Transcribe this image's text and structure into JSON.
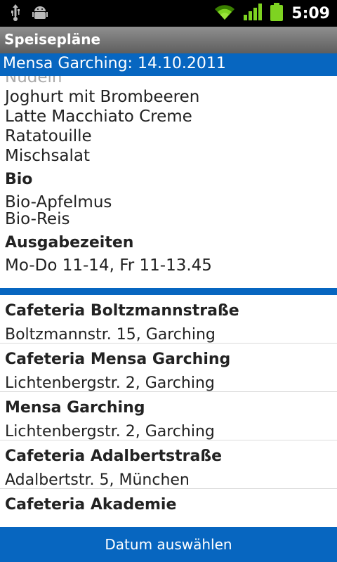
{
  "status_bar": {
    "time": "5:09",
    "icons": [
      "usb-icon",
      "android-debug-icon",
      "wifi-icon",
      "signal-icon",
      "battery-icon"
    ]
  },
  "app": {
    "title": "Speisepläne"
  },
  "header": {
    "title": "Mensa Garching: 14.10.2011"
  },
  "menu": {
    "items_top": [
      "Nudeln",
      "Joghurt mit Brombeeren",
      "Latte Macchiato Creme",
      "Ratatouille",
      "Mischsalat"
    ],
    "bio_heading": "Bio",
    "bio_items": [
      "Bio-Apfelmus",
      "Bio-Reis"
    ],
    "hours_heading": "Ausgabezeiten",
    "hours": "Mo-Do 11-14, Fr 11-13.45"
  },
  "locations": [
    {
      "name": "Cafeteria Boltzmannstraße",
      "address": "Boltzmannstr. 15, Garching"
    },
    {
      "name": "Cafeteria Mensa Garching",
      "address": "Lichtenbergstr. 2, Garching"
    },
    {
      "name": "Mensa Garching",
      "address": "Lichtenbergstr. 2, Garching"
    },
    {
      "name": "Cafeteria Adalbertstraße",
      "address": "Adalbertstr. 5, München"
    },
    {
      "name": "Cafeteria Akademie",
      "address": ""
    }
  ],
  "colors": {
    "accent": "#0766c0",
    "title_bar": "#6e6e6e",
    "status_bar": "#000000"
  },
  "button": {
    "label": "Datum auswählen"
  }
}
